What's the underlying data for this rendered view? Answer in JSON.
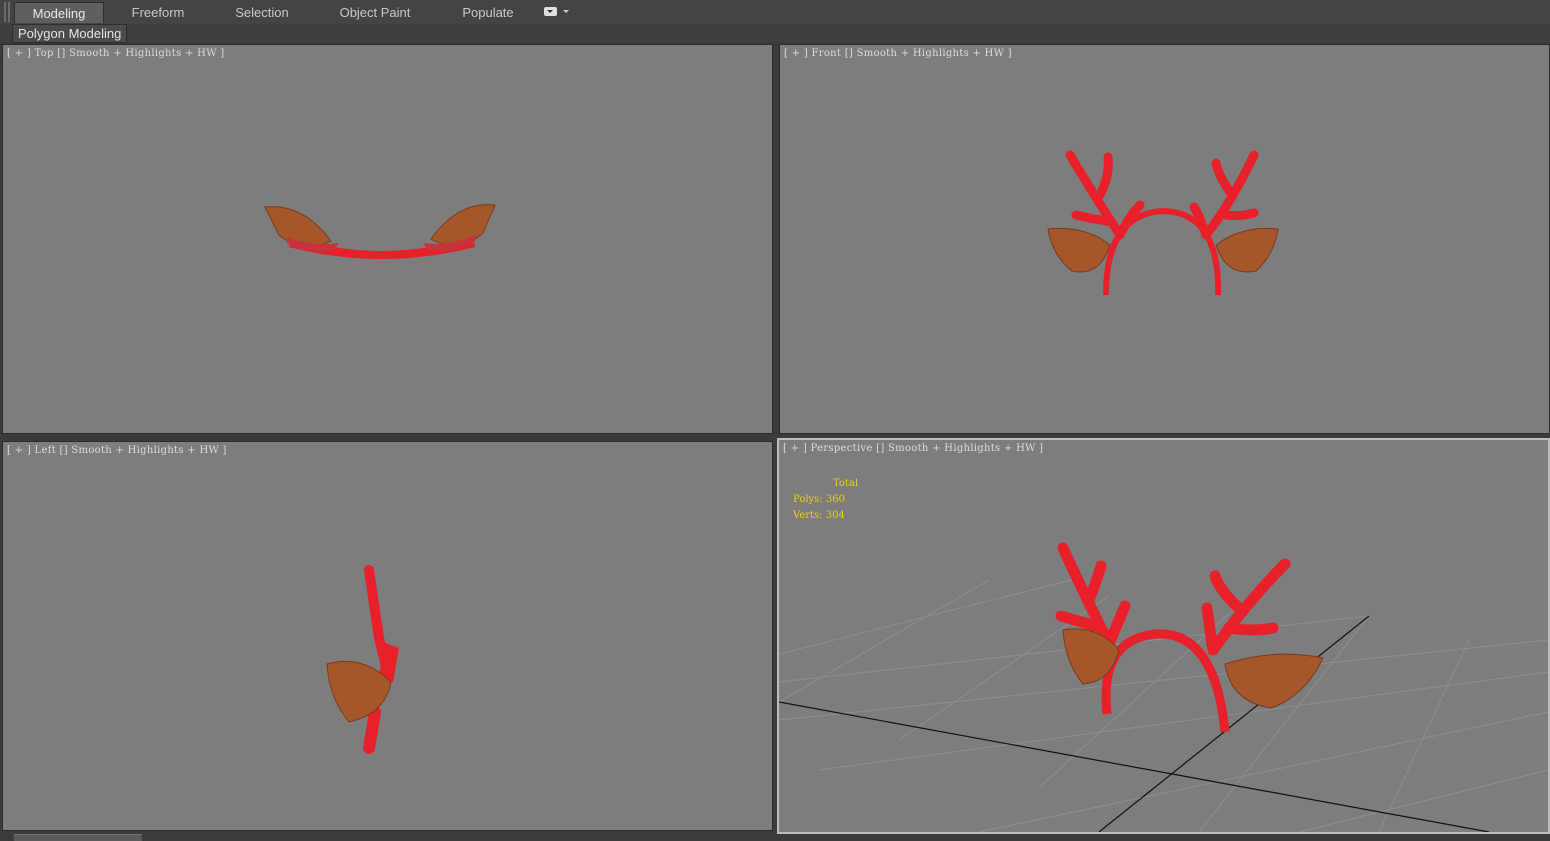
{
  "ribbon": {
    "tabs": [
      "Modeling",
      "Freeform",
      "Selection",
      "Object Paint",
      "Populate"
    ],
    "active_tab": "Modeling"
  },
  "panel": {
    "label": "Polygon Modeling"
  },
  "viewports": {
    "top": {
      "open": "[ + ]",
      "view": "Top",
      "shading": "Smooth + Highlights + HW ]"
    },
    "front": {
      "open": "[ + ]",
      "view": "Front",
      "shading": "Smooth + Highlights + HW ]"
    },
    "left": {
      "open": "[ + ]",
      "view": "Left",
      "shading": "Smooth + Highlights + HW ]"
    },
    "perspective": {
      "open": "[ + ]",
      "view": "Perspective",
      "shading": "Smooth + Highlights + HW ]"
    }
  },
  "stats": {
    "title": "Total",
    "polys_label": "Polys:",
    "polys": "360",
    "verts_label": "Verts:",
    "verts": "304"
  },
  "colors": {
    "viewport_bg": "#7d7d7d",
    "antler_red": "#e8202a",
    "ear_brown": "#a5562a",
    "stats_yellow": "#e8d21a",
    "grid_line": "#8e8e8e"
  }
}
